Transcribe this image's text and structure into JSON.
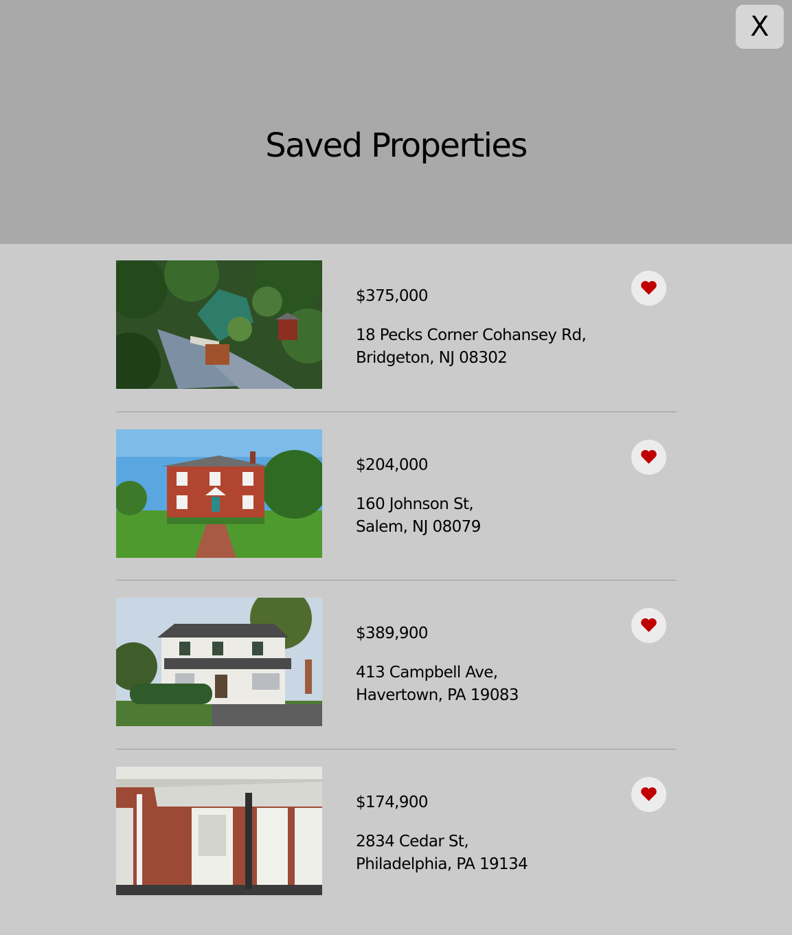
{
  "modal": {
    "title": "Saved Properties",
    "close_label": "X"
  },
  "properties": [
    {
      "price": "$375,000",
      "address_line1": "18 Pecks Corner Cohansey Rd,",
      "address_line2": "Bridgeton, NJ 08302",
      "icon": "heart-icon",
      "saved": true
    },
    {
      "price": "$204,000",
      "address_line1": "160 Johnson St,",
      "address_line2": "Salem, NJ 08079",
      "icon": "heart-icon",
      "saved": true
    },
    {
      "price": "$389,900",
      "address_line1": "413 Campbell Ave,",
      "address_line2": "Havertown, PA 19083",
      "icon": "heart-icon",
      "saved": true
    },
    {
      "price": "$174,900",
      "address_line1": "2834 Cedar St,",
      "address_line2": "Philadelphia, PA 19134",
      "icon": "heart-icon",
      "saved": true
    }
  ],
  "colors": {
    "header_bg": "#a9a9a9",
    "body_bg": "#cbcbcb",
    "heart": "#c00000"
  }
}
